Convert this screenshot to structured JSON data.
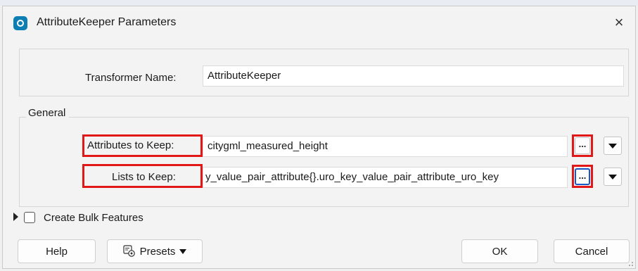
{
  "dialog": {
    "title": "AttributeKeeper Parameters",
    "close_symbol": "×"
  },
  "transformer": {
    "label": "Transformer Name:",
    "value": "AttributeKeeper"
  },
  "general": {
    "legend": "General",
    "attributes_to_keep": {
      "label": "Attributes to Keep:",
      "value": "citygml_measured_height",
      "ellipsis": "..."
    },
    "lists_to_keep": {
      "label": "Lists to Keep:",
      "value": "y_value_pair_attribute{}.uro_key_value_pair_attribute_uro_key",
      "ellipsis": "..."
    }
  },
  "bulk": {
    "label": "Create Bulk Features",
    "checked": false
  },
  "buttons": {
    "help": "Help",
    "presets": "Presets",
    "ok": "OK",
    "cancel": "Cancel"
  },
  "colors": {
    "highlight": "#e21818",
    "app_icon": "#0b7fb3",
    "focus": "#1a56c4"
  },
  "icons": {
    "app": "fme-app-icon",
    "close": "close-icon",
    "dropdown": "triangle-down-icon",
    "expand": "triangle-right-icon",
    "presets": "presets-gear-icon"
  }
}
